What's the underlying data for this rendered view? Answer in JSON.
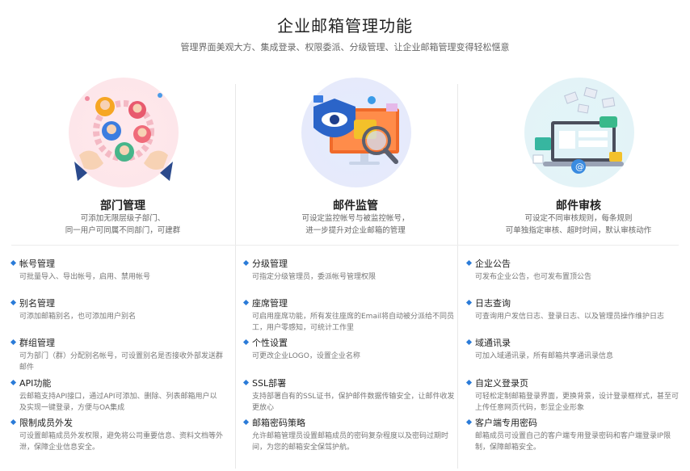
{
  "header": {
    "title": "企业邮箱管理功能",
    "subtitle": "管理界面美观大方、集成登录、权限委派、分级管理、让企业邮箱管理变得轻松惬意"
  },
  "colors": {
    "accent": "#2a7bd8",
    "text": "#222222",
    "muted": "#777777"
  },
  "columns": [
    {
      "icon": "department-people-icon",
      "title": "部门管理",
      "desc": [
        "可添加无限层级子部门、",
        "同一用户可同属不同部门，可建群"
      ],
      "features": [
        {
          "title": "帐号管理",
          "desc": "可批量导入、导出帐号，启用、禁用帐号"
        },
        {
          "title": "别名管理",
          "desc": "可添加邮箱别名，也可添加用户别名"
        },
        {
          "title": "群组管理",
          "desc": "可为部门（群）分配别名帐号，可设置别名是否接收外部发送群邮件"
        },
        {
          "title": "API功能",
          "desc": "云邮箱支持API接口，通过API可添加、删除、列表邮箱用户以及实现一键登录，方便与OA集成"
        },
        {
          "title": "限制成员外发",
          "desc": "可设置邮箱成员外发权限，避免将公司重要信息、资料文档等外泄，保障企业信息安全。"
        }
      ]
    },
    {
      "icon": "monitor-eye-icon",
      "title": "邮件监管",
      "desc": [
        "可设定监控帐号与被监控帐号，",
        "进一步提升对企业邮箱的管理"
      ],
      "features": [
        {
          "title": "分级管理",
          "desc": "可指定分级管理员，委派帐号管理权限"
        },
        {
          "title": "座席管理",
          "desc": "可启用座席功能，所有发往座席的Email将自动被分派给不同员工，用户零感知，可统计工作里"
        },
        {
          "title": "个性设置",
          "desc": "可更改企业LOGO，设置企业名称"
        },
        {
          "title": "SSL部署",
          "desc": "支持部署自有的SSL证书，保护邮件数据传输安全，让邮件收发更放心"
        },
        {
          "title": "邮箱密码策略",
          "desc": "允许邮箱管理员设置邮箱成员的密码复杂程度以及密码过期时间，为您的邮箱安全保驾护航。"
        }
      ]
    },
    {
      "icon": "laptop-mail-icon",
      "title": "邮件审核",
      "desc": [
        "可设定不同审核规则，每条规则",
        "可单独指定审核、超时时间，默认审核动作"
      ],
      "features": [
        {
          "title": "企业公告",
          "desc": "可发布企业公告，也可发布置顶公告"
        },
        {
          "title": "日志查询",
          "desc": "可查询用户发信日志、登录日志、以及管理员操作维护日志"
        },
        {
          "title": "域通讯录",
          "desc": "可加入域通讯录，所有邮箱共享通讯录信息"
        },
        {
          "title": "自定义登录页",
          "desc": "可轻松定制邮箱登录界面，更换背景，设计登录框样式，甚至可上传任意网页代码，彰显企业形象"
        },
        {
          "title": "客户端专用密码",
          "desc": "邮箱成员可设置自己的客户端专用登录密码和客户端登录IP限制，保障邮箱安全。"
        }
      ]
    }
  ]
}
